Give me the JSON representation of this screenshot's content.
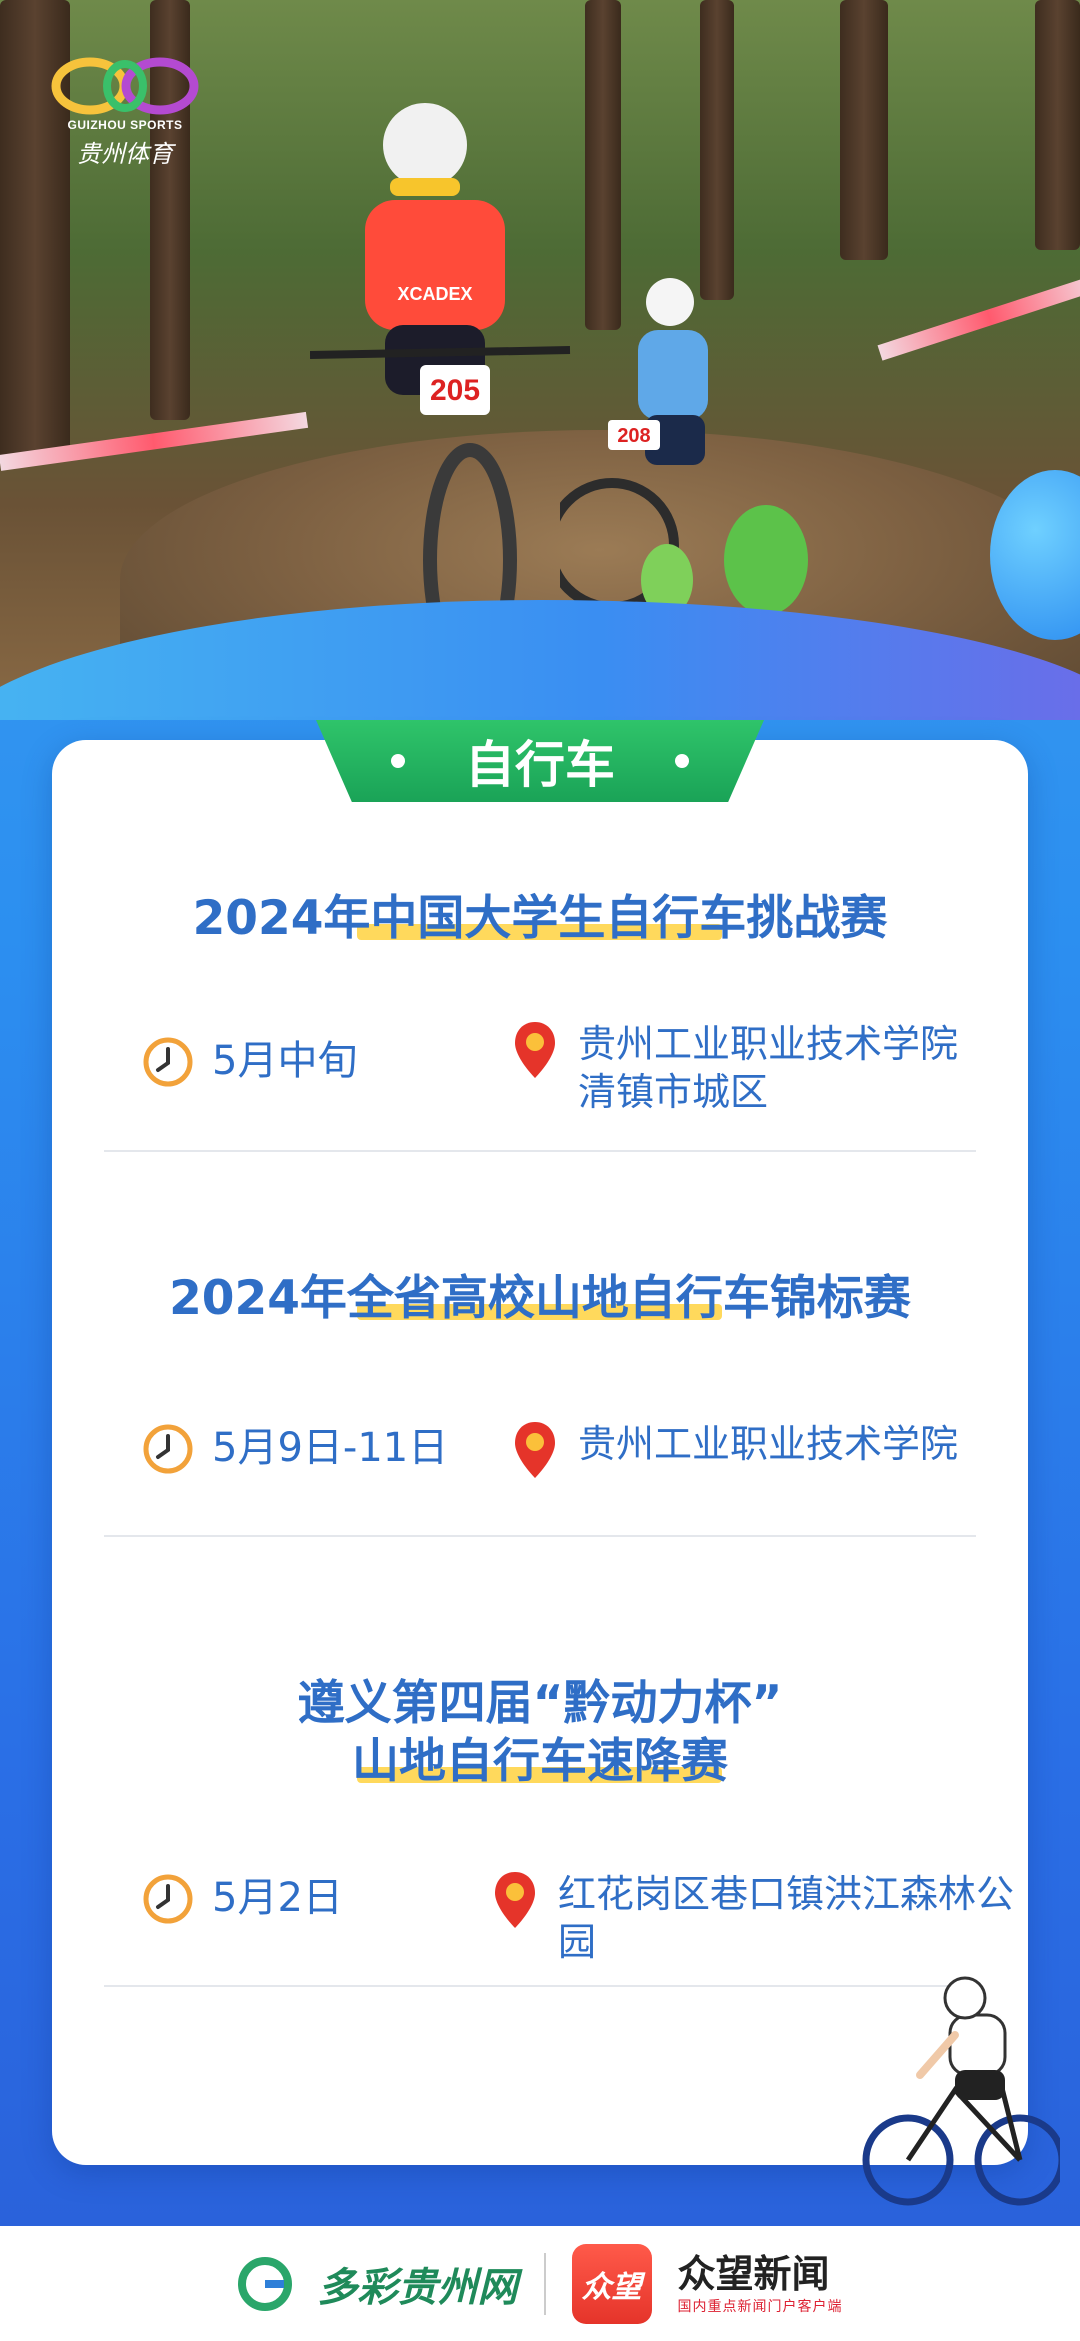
{
  "logo": {
    "en": "GUIZHOU SPORTS",
    "cn": "贵州体育"
  },
  "hero": {
    "bib_main": "205",
    "bib_second": "208",
    "jersey_text": "XCADEX"
  },
  "section_tab": "自行车",
  "events": [
    {
      "title_lines": [
        "2024年中国大学生自行车挑战赛"
      ],
      "date": "5月中旬",
      "location_lines": [
        "贵州工业职业技术学院",
        "清镇市城区"
      ]
    },
    {
      "title_lines": [
        "2024年全省高校山地自行车锦标赛"
      ],
      "date": "5月9日-11日",
      "location_lines": [
        "贵州工业职业技术学院"
      ]
    },
    {
      "title_lines": [
        "遵义第四届“黔动力杯”",
        "山地自行车速降赛"
      ],
      "date": "5月2日",
      "location_lines": [
        "红花岗区巷口镇洪江森林公园"
      ]
    }
  ],
  "footer": {
    "brand1": "多彩贵州网",
    "badge": "众望",
    "brand2": "众望新闻",
    "brand2_sub": "国内重点新闻门户客户端"
  },
  "colors": {
    "title_blue": "#2f6ec6",
    "tab_green": "#1aa357",
    "highlight_yellow": "#ffd23f",
    "clock_orange": "#f2a23a",
    "pin_red": "#e5342a"
  },
  "icons": [
    "clock-icon",
    "location-pin-icon",
    "cyclist-illustration",
    "tree-illustration"
  ]
}
